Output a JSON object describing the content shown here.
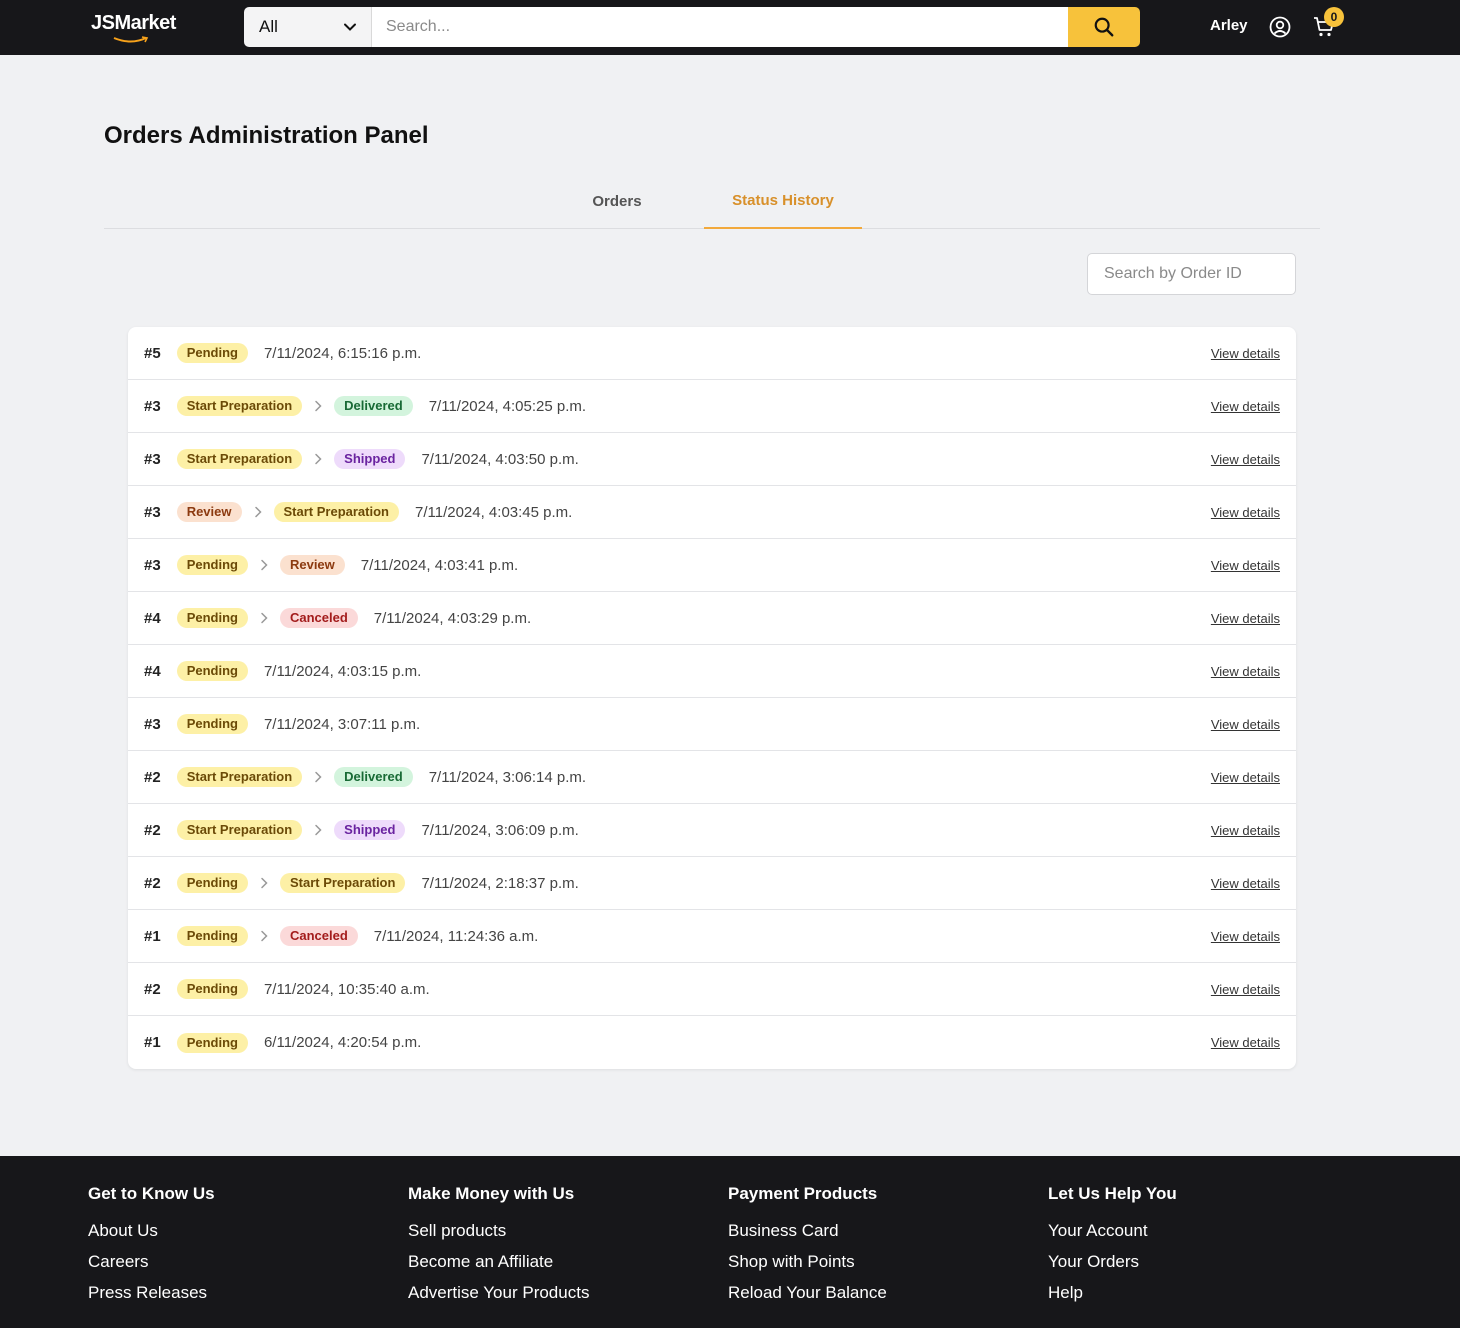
{
  "header": {
    "logo": "JSMarket",
    "category": "All",
    "search_placeholder": "Search...",
    "user_name": "Arley",
    "cart_count": "0"
  },
  "main": {
    "title": "Orders Administration Panel",
    "tabs": [
      {
        "label": "Orders",
        "active": false
      },
      {
        "label": "Status History",
        "active": true
      }
    ],
    "order_search_placeholder": "Search by Order ID",
    "view_label": "View details",
    "rows": [
      {
        "id": "#5",
        "from": "Pending",
        "to": null,
        "date": "7/11/2024, 6:15:16 p.m."
      },
      {
        "id": "#3",
        "from": "Start Preparation",
        "to": "Delivered",
        "date": "7/11/2024, 4:05:25 p.m."
      },
      {
        "id": "#3",
        "from": "Start Preparation",
        "to": "Shipped",
        "date": "7/11/2024, 4:03:50 p.m."
      },
      {
        "id": "#3",
        "from": "Review",
        "to": "Start Preparation",
        "date": "7/11/2024, 4:03:45 p.m."
      },
      {
        "id": "#3",
        "from": "Pending",
        "to": "Review",
        "date": "7/11/2024, 4:03:41 p.m."
      },
      {
        "id": "#4",
        "from": "Pending",
        "to": "Canceled",
        "date": "7/11/2024, 4:03:29 p.m."
      },
      {
        "id": "#4",
        "from": "Pending",
        "to": null,
        "date": "7/11/2024, 4:03:15 p.m."
      },
      {
        "id": "#3",
        "from": "Pending",
        "to": null,
        "date": "7/11/2024, 3:07:11 p.m."
      },
      {
        "id": "#2",
        "from": "Start Preparation",
        "to": "Delivered",
        "date": "7/11/2024, 3:06:14 p.m."
      },
      {
        "id": "#2",
        "from": "Start Preparation",
        "to": "Shipped",
        "date": "7/11/2024, 3:06:09 p.m."
      },
      {
        "id": "#2",
        "from": "Pending",
        "to": "Start Preparation",
        "date": "7/11/2024, 2:18:37 p.m."
      },
      {
        "id": "#1",
        "from": "Pending",
        "to": "Canceled",
        "date": "7/11/2024, 11:24:36 a.m."
      },
      {
        "id": "#2",
        "from": "Pending",
        "to": null,
        "date": "7/11/2024, 10:35:40 a.m."
      },
      {
        "id": "#1",
        "from": "Pending",
        "to": null,
        "date": "6/11/2024, 4:20:54 p.m."
      }
    ]
  },
  "status_colors": {
    "Pending": "#fdf0a6",
    "Start Preparation": "#fdf0a6",
    "Review": "#fbe1cf",
    "Delivered": "#d3f4dd",
    "Shipped": "#eedbfb",
    "Canceled": "#fbd9d9"
  },
  "accent_color": "#f7c23b",
  "footer": {
    "columns": [
      {
        "title": "Get to Know Us",
        "links": [
          "About Us",
          "Careers",
          "Press Releases"
        ]
      },
      {
        "title": "Make Money with Us",
        "links": [
          "Sell products",
          "Become an Affiliate",
          "Advertise Your Products"
        ]
      },
      {
        "title": "Payment Products",
        "links": [
          "Business Card",
          "Shop with Points",
          "Reload Your Balance"
        ]
      },
      {
        "title": "Let Us Help You",
        "links": [
          "Your Account",
          "Your Orders",
          "Help"
        ]
      }
    ]
  }
}
